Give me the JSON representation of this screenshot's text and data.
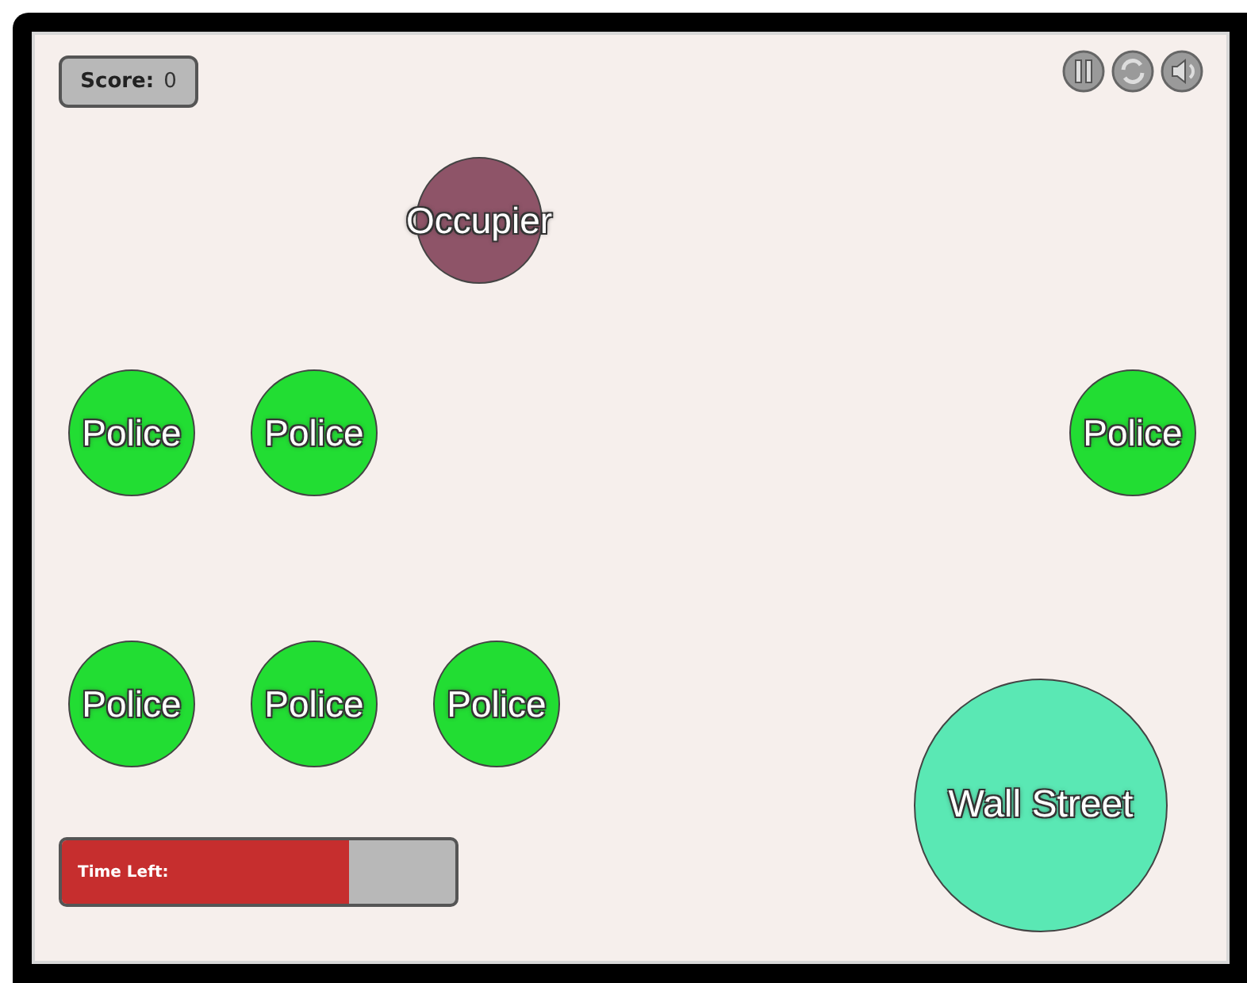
{
  "score": {
    "label": "Score:",
    "value": "0"
  },
  "controls": [
    {
      "kind": "pause"
    },
    {
      "kind": "restart"
    },
    {
      "kind": "sound"
    }
  ],
  "nodes": [
    {
      "label": "Occupier",
      "kind": "player",
      "color": "#8e5468"
    },
    {
      "label": "Police",
      "kind": "police",
      "color": "#22dd33"
    },
    {
      "label": "Police",
      "kind": "police",
      "color": "#22dd33"
    },
    {
      "label": "Police",
      "kind": "police",
      "color": "#22dd33"
    },
    {
      "label": "Police",
      "kind": "police",
      "color": "#22dd33"
    },
    {
      "label": "Police",
      "kind": "police",
      "color": "#22dd33"
    },
    {
      "label": "Police",
      "kind": "police",
      "color": "#22dd33"
    },
    {
      "label": "Wall Street",
      "kind": "goal",
      "color": "#5ae8b4"
    }
  ],
  "timer": {
    "label": "Time Left:",
    "level": 0.73
  }
}
